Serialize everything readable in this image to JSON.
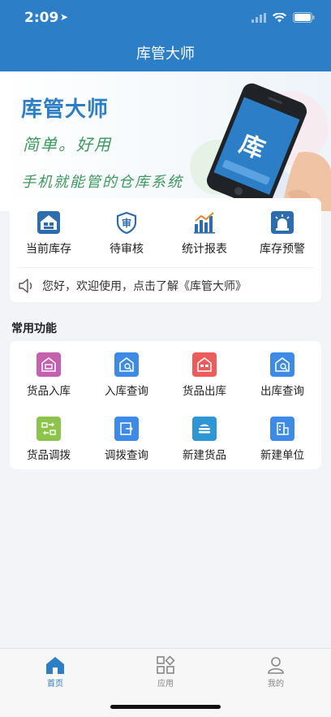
{
  "status_bar": {
    "time": "2:09",
    "location_glyph": "➤"
  },
  "header": {
    "title": "库管大师"
  },
  "banner": {
    "title": "库管大师",
    "subtitle1": "简单。好用",
    "subtitle2": "手机就能管的仓库系统",
    "phone_char": "库"
  },
  "quick_actions": [
    {
      "label": "当前库存",
      "icon": "warehouse-icon"
    },
    {
      "label": "待审核",
      "icon": "review-shield-icon"
    },
    {
      "label": "统计报表",
      "icon": "bar-chart-icon"
    },
    {
      "label": "库存预警",
      "icon": "alarm-light-icon"
    }
  ],
  "notice": {
    "text": "您好，欢迎使用，点击了解《库管大师》",
    "icon": "speaker-icon"
  },
  "section": {
    "title": "常用功能"
  },
  "functions": [
    {
      "label": "货品入库",
      "color": "#c75fb0"
    },
    {
      "label": "入库查询",
      "color": "#3d8be6"
    },
    {
      "label": "货品出库",
      "color": "#ef5b5b"
    },
    {
      "label": "出库查询",
      "color": "#3d8be6"
    },
    {
      "label": "货品调拨",
      "color": "#8cc34a"
    },
    {
      "label": "调拨查询",
      "color": "#3d8be6"
    },
    {
      "label": "新建货品",
      "color": "#2e96d4"
    },
    {
      "label": "新建单位",
      "color": "#3d8be6"
    }
  ],
  "tabs": [
    {
      "label": "首页",
      "active": true,
      "icon": "home-icon"
    },
    {
      "label": "应用",
      "active": false,
      "icon": "apps-icon"
    },
    {
      "label": "我的",
      "active": false,
      "icon": "profile-icon"
    }
  ],
  "colors": {
    "primary": "#2c7ec7",
    "accent_green": "#3c9a5c",
    "inactive": "#888888"
  }
}
